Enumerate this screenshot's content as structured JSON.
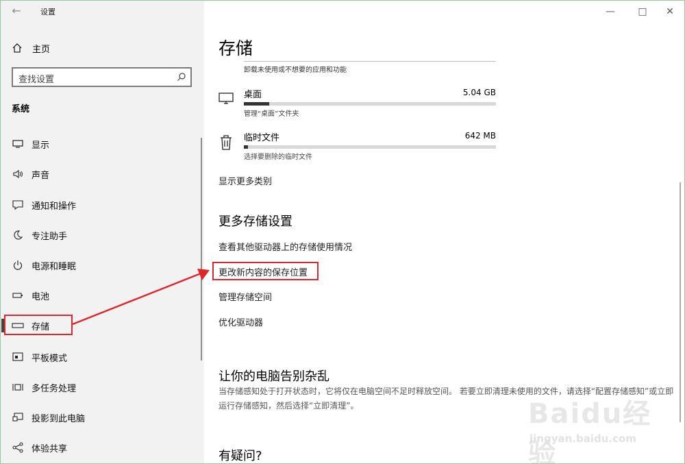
{
  "window": {
    "title": "设置",
    "controls": [
      "minimize-icon",
      "maximize-icon",
      "close-icon"
    ]
  },
  "sidebar": {
    "home_label": "主页",
    "search_placeholder": "查找设置",
    "category": "系统",
    "items": [
      {
        "label": "显示",
        "icon": "display-icon",
        "selected": false
      },
      {
        "label": "声音",
        "icon": "speaker-icon",
        "selected": false
      },
      {
        "label": "通知和操作",
        "icon": "notification-icon",
        "selected": false
      },
      {
        "label": "专注助手",
        "icon": "moon-icon",
        "selected": false
      },
      {
        "label": "电源和睡眠",
        "icon": "power-icon",
        "selected": false
      },
      {
        "label": "电池",
        "icon": "battery-icon",
        "selected": false
      },
      {
        "label": "存储",
        "icon": "storage-icon",
        "selected": true
      },
      {
        "label": "平板模式",
        "icon": "tablet-icon",
        "selected": false
      },
      {
        "label": "多任务处理",
        "icon": "multitask-icon",
        "selected": false
      },
      {
        "label": "投影到此电脑",
        "icon": "project-icon",
        "selected": false
      },
      {
        "label": "体验共享",
        "icon": "share-icon",
        "selected": false
      }
    ]
  },
  "main": {
    "title": "存储",
    "top_desc": "卸载未使用或不想要的应用和功能",
    "rows": [
      {
        "name": "桌面",
        "size": "5.04 GB",
        "desc": "管理“桌面”文件夹",
        "icon": "monitor-icon",
        "usage": 0.1
      },
      {
        "name": "临时文件",
        "size": "642 MB",
        "desc": "选择要删除的临时文件",
        "icon": "trash-icon",
        "usage": 0.015
      }
    ],
    "show_more": "显示更多类别",
    "more_heading": "更多存储设置",
    "links": [
      "查看其他驱动器上的存储使用情况",
      "更改新内容的保存位置",
      "管理存储空间",
      "优化驱动器"
    ],
    "clean_heading": "让你的电脑告别杂乱",
    "clean_text": "当存储感知处于打开状态时，它将仅在电脑空间不足时释放空间。 若要立即清理未使用的文件，请选择“配置存储感知”或立即运行存储感知，然后选择“立即清理”。",
    "question_heading": "有疑问?"
  },
  "watermark": {
    "logo": "Baidu经验",
    "url": "jingyan.baidu.com"
  },
  "colors": {
    "annotation": "#e0262b",
    "sidebar_bg": "#f2f2f2"
  }
}
